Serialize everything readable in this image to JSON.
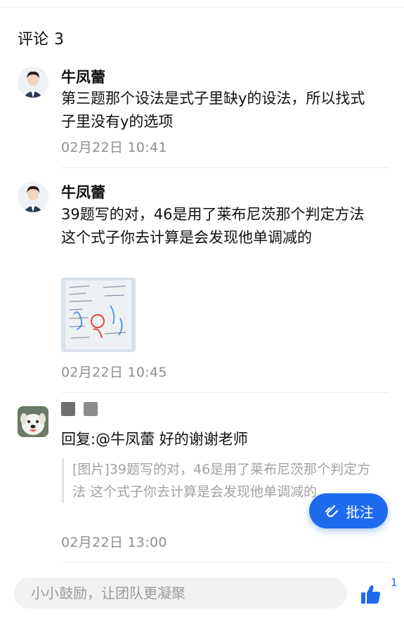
{
  "comments_section": {
    "title": "评论",
    "count": "3"
  },
  "comments": [
    {
      "author": "牛凤蕾",
      "text": "第三题那个设法是式子里缺y的设法，所以找式子里没有y的选项",
      "time": "02月22日 10:41"
    },
    {
      "author": "牛凤蕾",
      "text": "39题写的对，46是用了莱布尼茨那个判定方法 这个式子你去计算是会发现他单调减的",
      "time": "02月22日 10:45"
    },
    {
      "author": "",
      "reply_text": "回复:@牛凤蕾 好的谢谢老师",
      "quote": "[图片]39题写的对，46是用了莱布尼茨那个判定方法 这个式子你去计算是会发现他单调减的",
      "time": "02月22日 13:00"
    }
  ],
  "fab": {
    "label": "批注"
  },
  "input": {
    "placeholder": "小小鼓励，让团队更凝聚"
  },
  "like": {
    "count": "1"
  },
  "colors": {
    "accent": "#1f6bf0",
    "muted": "#8e8e8e"
  }
}
